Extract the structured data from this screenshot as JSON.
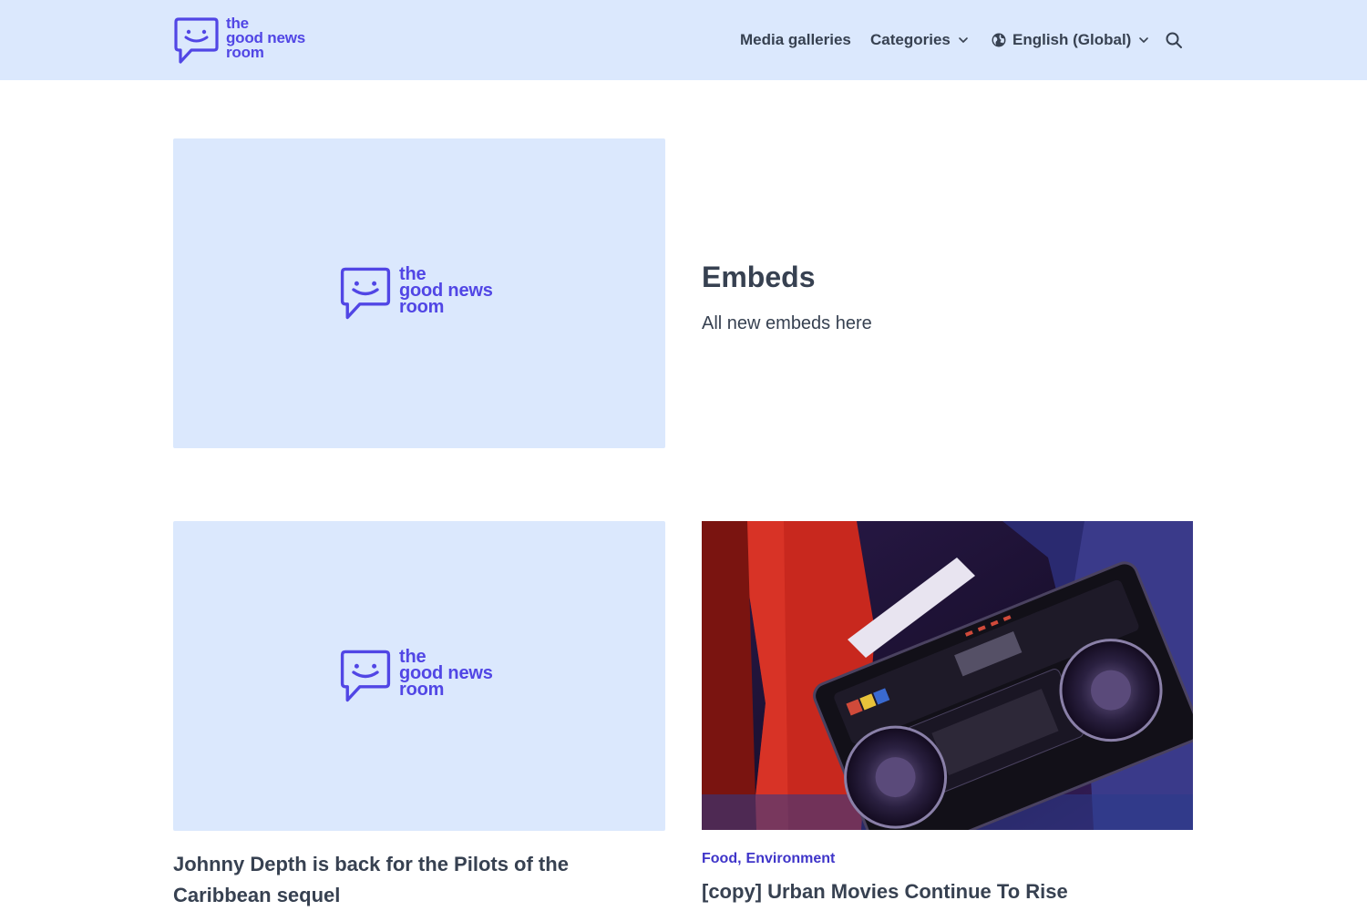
{
  "header": {
    "logo": {
      "line1": "the",
      "line2": "good news",
      "line3": "room"
    },
    "nav": {
      "media_galleries": "Media galleries",
      "categories": "Categories",
      "language": "English (Global)"
    }
  },
  "hero": {
    "placeholder_logo": {
      "line1": "the",
      "line2": "good news",
      "line3": "room"
    },
    "title": "Embeds",
    "description": "All new embeds here"
  },
  "articles": [
    {
      "placeholder_logo": {
        "line1": "the",
        "line2": "good news",
        "line3": "room"
      },
      "title": "Johnny Depth is back for the Pilots of the Caribbean sequel"
    },
    {
      "categories": [
        "Food",
        "Environment"
      ],
      "category_separator": ",",
      "title": "[copy] Urban Movies Continue To Rise"
    }
  ],
  "colors": {
    "brand": "#5146e5",
    "header_bg": "#dbe8fd",
    "text": "#374151",
    "category_link": "#3f35c9"
  }
}
